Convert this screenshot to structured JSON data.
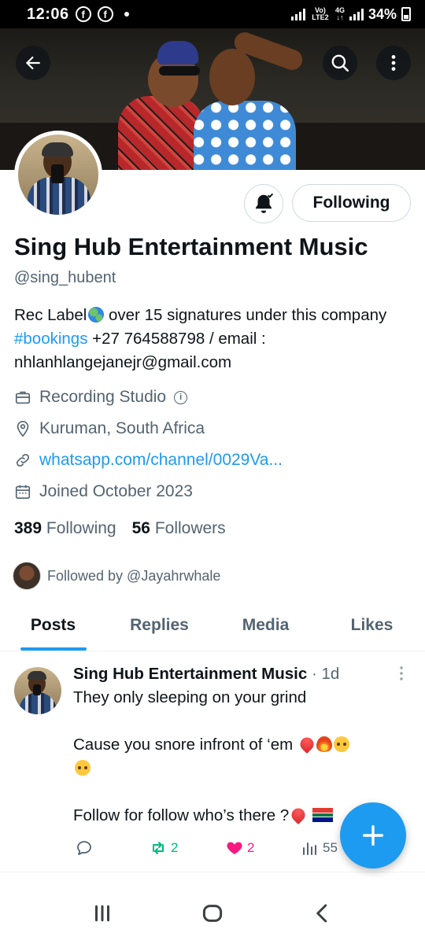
{
  "status_bar": {
    "time": "12:06",
    "battery": "34%",
    "net_top": "Vo) LTE2",
    "net_4g": "4G"
  },
  "profile": {
    "display_name": "Sing Hub Entertainment Music",
    "handle": "@sing_hubent",
    "bio_before_globe": "Rec Label",
    "bio_after_globe": " over 15 signatures under this company ",
    "bio_hashtag": "#bookings",
    "bio_rest": " +27 764588798 / email : nhlanhlangejanejr@gmail.com",
    "category": "Recording Studio",
    "location": "Kuruman, South Africa",
    "website": "whatsapp.com/channel/0029Va...",
    "joined": "Joined October 2023",
    "following_count": "389",
    "following_label": "Following",
    "followers_count": "56",
    "followers_label": "Followers",
    "followed_by": "Followed by @Jayahrwhale"
  },
  "actions": {
    "follow_state": "Following"
  },
  "tabs": [
    {
      "label": "Posts",
      "active": true
    },
    {
      "label": "Replies",
      "active": false
    },
    {
      "label": "Media",
      "active": false
    },
    {
      "label": "Likes",
      "active": false
    }
  ],
  "post": {
    "author": "Sing Hub Entertainment Music",
    "time": " · 1d",
    "line1": "They only sleeping on your grind",
    "line2": "Cause you snore infront of ‘em",
    "line3": "Follow for follow who’s there ?",
    "replies": "",
    "retweets": "2",
    "likes": "2",
    "views": "55"
  },
  "colors": {
    "accent": "#1d9bf0",
    "retweet": "#00ba7c",
    "like": "#f91880",
    "secondary_text": "#536471"
  }
}
